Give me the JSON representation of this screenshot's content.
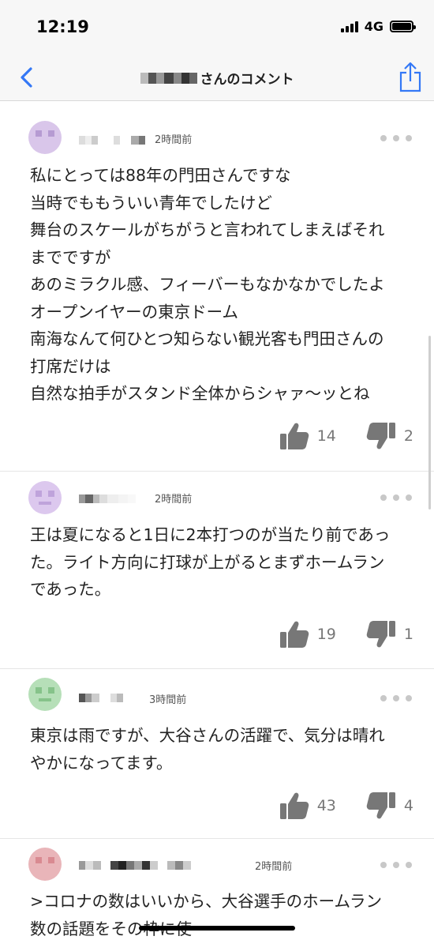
{
  "status_bar": {
    "time": "12:19",
    "network": "4G"
  },
  "nav": {
    "title": "さんのコメント",
    "back_icon": "chevron-left-icon",
    "share_icon": "share-icon",
    "accent": "#3478f6"
  },
  "comments": [
    {
      "time_ago": "2時間前",
      "body": "私にとっては88年の門田さんですな\n当時でももういい青年でしたけど\n舞台のスケールがちがうと言われてしまえばそれ\nまでですが\nあのミラクル感、フィーバーもなかなかでしたよ\nオープンイヤーの東京ドーム\n南海なんて何ひとつ知らない観光客も門田さんの\n打席だけは\n自然な拍手がスタンド全体からシャァ〜ッとね",
      "likes": "14",
      "dislikes": "2",
      "avatar_color": "#d9c6ea"
    },
    {
      "time_ago": "2時間前",
      "body": "王は夏になると1日に2本打つのが当たり前であっ\nた。ライト方向に打球が上がるとまずホームラン\nであった。",
      "likes": "19",
      "dislikes": "1",
      "avatar_color": "#dcc8ee"
    },
    {
      "time_ago": "3時間前",
      "body": "東京は雨ですが、大谷さんの活躍で、気分は晴れ\nやかになってます。",
      "likes": "43",
      "dislikes": "4",
      "avatar_color": "#b6dfb8"
    },
    {
      "time_ago": "2時間前",
      "body": ">コロナの数はいいから、大谷選手のホームラン\n数の話題をその枠に使",
      "likes": "",
      "dislikes": "",
      "avatar_color": "#e9b5b9"
    }
  ],
  "colors": {
    "icon_gray": "#777777",
    "dots": "#c8c8c8"
  }
}
